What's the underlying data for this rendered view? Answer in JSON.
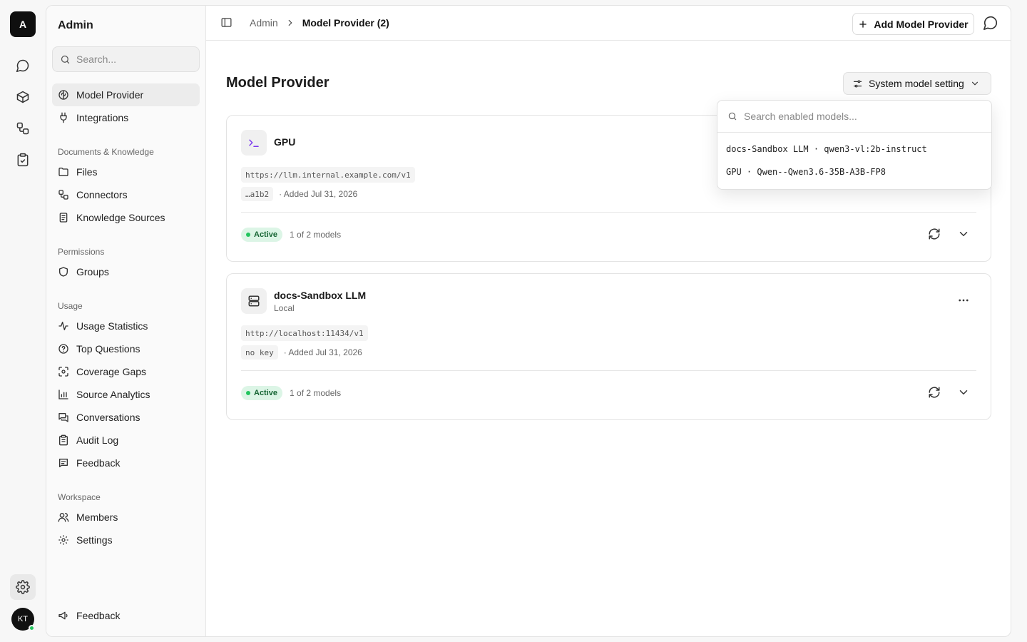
{
  "rail": {
    "logo": "A",
    "avatar": "KT"
  },
  "sidebar": {
    "title": "Admin",
    "search_placeholder": "Search...",
    "top_items": [
      {
        "label": "Model Provider"
      },
      {
        "label": "Integrations"
      }
    ],
    "groups": [
      {
        "label": "Documents & Knowledge",
        "items": [
          "Files",
          "Connectors",
          "Knowledge Sources"
        ]
      },
      {
        "label": "Permissions",
        "items": [
          "Groups"
        ]
      },
      {
        "label": "Usage",
        "items": [
          "Usage Statistics",
          "Top Questions",
          "Coverage Gaps",
          "Source Analytics",
          "Conversations",
          "Audit Log",
          "Feedback"
        ]
      },
      {
        "label": "Workspace",
        "items": [
          "Members",
          "Settings"
        ]
      }
    ],
    "footer_feedback": "Feedback"
  },
  "header": {
    "breadcrumb_root": "Admin",
    "breadcrumb_current": "Model Provider (2)",
    "add_button": "Add Model Provider"
  },
  "main": {
    "title": "Model Provider",
    "system_setting_button": "System model setting"
  },
  "dropdown": {
    "search_placeholder": "Search enabled models...",
    "items": [
      "docs-Sandbox LLM · qwen3-vl:2b-instruct",
      "GPU · Qwen--Qwen3.6-35B-A3B-FP8"
    ]
  },
  "providers": [
    {
      "name": "GPU",
      "subtitle": "",
      "url": "https://llm.internal.example.com/v1",
      "key": "…a1b2",
      "added": "· Added Jul 31, 2026",
      "status": "Active",
      "models": "1 of 2 models"
    },
    {
      "name": "docs-Sandbox LLM",
      "subtitle": "Local",
      "url": "http://localhost:11434/v1",
      "key": "no key",
      "added": "· Added Jul 31, 2026",
      "status": "Active",
      "models": "1 of 2 models"
    }
  ],
  "colors": {
    "active_badge_bg": "#dcf5e6",
    "active_dot": "#22c55e",
    "online_dot": "#22c55e"
  }
}
